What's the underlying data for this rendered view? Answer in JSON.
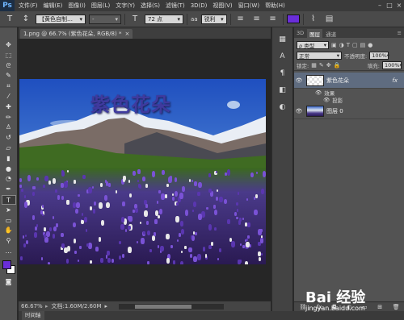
{
  "app": {
    "logo": "Ps"
  },
  "menu": [
    "文件(F)",
    "编辑(E)",
    "图像(I)",
    "图层(L)",
    "文字(Y)",
    "选择(S)",
    "滤镜(T)",
    "3D(D)",
    "视图(V)",
    "窗口(W)",
    "帮助(H)"
  ],
  "options": {
    "font_family": "【黄色自制…",
    "font_style": "-",
    "font_size": "72 点",
    "aa_label": "aa",
    "aa_mode": "锐利",
    "text_color": "#6a2ed8"
  },
  "document": {
    "tab_title": "1.png @ 66.7% (紫色花朵, RGB/8) *"
  },
  "canvas_text": "紫色花朵",
  "status": {
    "zoom": "66.67%",
    "doc_size": "文档:1.60M/2.60M"
  },
  "bottom_tab": "时间轴",
  "colors": {
    "foreground": "#6a2ed8",
    "background": "#ffffff"
  },
  "layers_panel": {
    "tabs": [
      "3D",
      "图层",
      "通道"
    ],
    "kind_filter": "ρ 类型",
    "blend_mode": "正常",
    "opacity_label": "不透明度:",
    "opacity_value": "100%",
    "lock_label": "锁定:",
    "fill_label": "填充:",
    "fill_value": "100%",
    "layers": [
      {
        "name": "紫色花朵",
        "fx": "fx",
        "effects_label": "效果",
        "effect": "投影"
      },
      {
        "name": "图层 0"
      }
    ]
  },
  "watermark": {
    "text": "Bai 经验",
    "url": "jingyan.baidu.com"
  }
}
